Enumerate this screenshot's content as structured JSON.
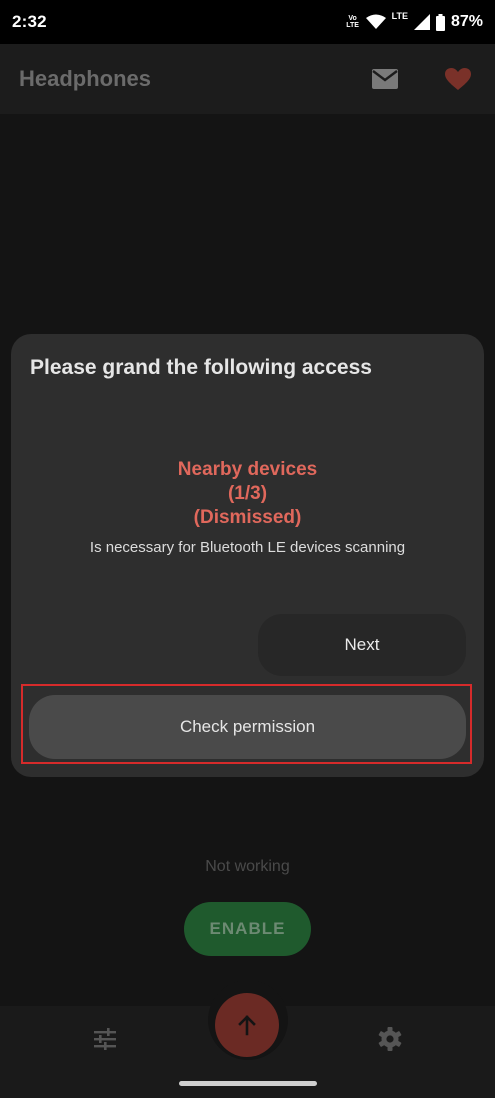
{
  "status_bar": {
    "time": "2:32",
    "volte_label": "Vo LTE",
    "lte_label": "LTE",
    "battery": "87%"
  },
  "app_bar": {
    "title": "Headphones"
  },
  "main": {
    "status_text": "Not working",
    "enable_label": "ENABLE"
  },
  "dialog": {
    "title": "Please grand the following access",
    "permission_name": "Nearby devices",
    "progress": "(1/3)",
    "state": "(Dismissed)",
    "description": "Is necessary for Bluetooth LE devices scanning",
    "next_label": "Next",
    "check_label": "Check permission"
  },
  "colors": {
    "accent_red": "#e0685c",
    "highlight": "#d62b2b",
    "enable_green": "#1f5a2d"
  },
  "icons": {
    "mail": "mail-icon",
    "favorite": "heart-icon",
    "equalizer": "sliders-icon",
    "settings": "gear-icon",
    "fab": "arrow-up-icon"
  }
}
